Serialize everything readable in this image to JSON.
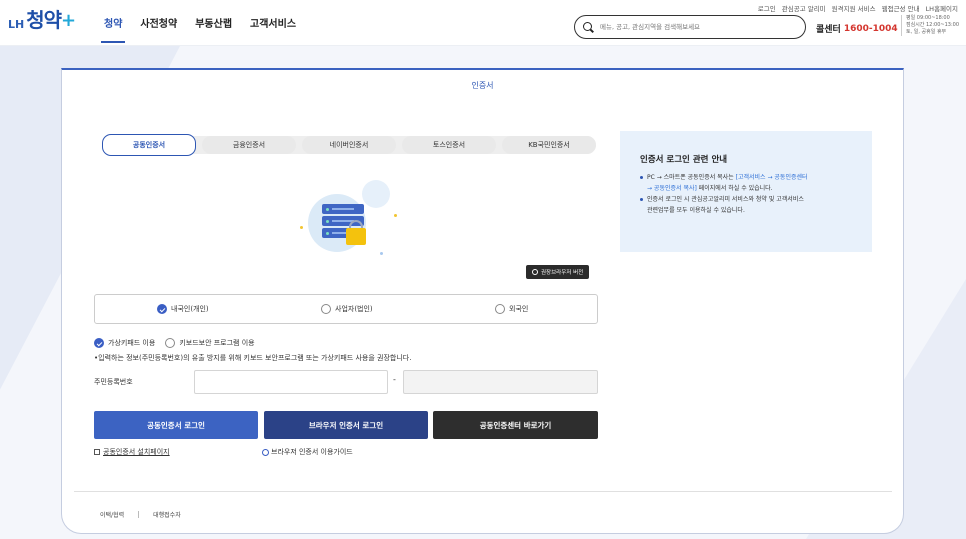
{
  "header": {
    "logo_lh": "LH",
    "logo_main": "청약",
    "logo_plus": "+",
    "util_links": [
      "로그인",
      "관심공고 알리미",
      "원격지원 서비스",
      "웹접근성 안내",
      "LH홈페이지"
    ],
    "nav": [
      "청약",
      "사전청약",
      "부동산랩",
      "고객서비스"
    ],
    "active_nav": "청약",
    "search_placeholder": "메뉴, 공고, 관심지역을 검색해보세요",
    "callcenter_label": "콜센터",
    "callcenter_number": "1600-1004",
    "callcenter_hours": [
      "평일 09:00~18:00",
      "점심시간 12:00~13:00",
      "토, 일, 공휴일 휴무"
    ]
  },
  "page": {
    "title": "인증서",
    "tabs": [
      "공동인증서",
      "금융인증서",
      "네이버인증서",
      "토스인증서",
      "KB국민인증서"
    ],
    "active_tab": "공동인증서",
    "browser_version_button": "권장브라우저 버전",
    "user_types": [
      "내국인(개인)",
      "사업자(법인)",
      "외국인"
    ],
    "selected_user_type": "내국인(개인)",
    "input_methods": [
      "가상키패드 이용",
      "키보드보안 프로그램 이용"
    ],
    "selected_input_method": "가상키패드 이용",
    "notice": "•입력하는 정보(주민등록번호)의 유출 방지를 위해 키보드 보안프로그램 또는 가상키패드 사용을 권장합니다.",
    "ssn_label": "주민등록번호",
    "ssn_dash": "-",
    "buttons": {
      "cert_login": "공동인증서 로그인",
      "browser_login": "브라우저 인증서 로그인",
      "center_shortcut": "공동인증센터 바로가기"
    },
    "links": {
      "install": "공동인증서 설치페이지",
      "guide": "브라우저 인증서 이용가이드"
    },
    "footer": [
      "이택/협력",
      "대행접수자"
    ]
  },
  "guide": {
    "title": "인증서 로그인 관련 안내",
    "item1_pre": "PC → 스마트폰 공동인증서 복사는 ",
    "item1_hl1": "[고객서비스 → 공동인증센터",
    "item1_hl2": "→ 공동인증서 복사]",
    "item1_post": " 페이지에서 하실 수 있습니다.",
    "item2_line1": "인증서 로그인 시 관심공고알리미 서비스와 청약 및 고객서비스",
    "item2_line2": "관련업무를 모두 이용하실 수 있습니다."
  },
  "colors": {
    "primary": "#2d56b3",
    "callcenter_number": "#d4362f",
    "dark_button": "#2e2e2e",
    "guide_bg": "#e8f1fb"
  }
}
